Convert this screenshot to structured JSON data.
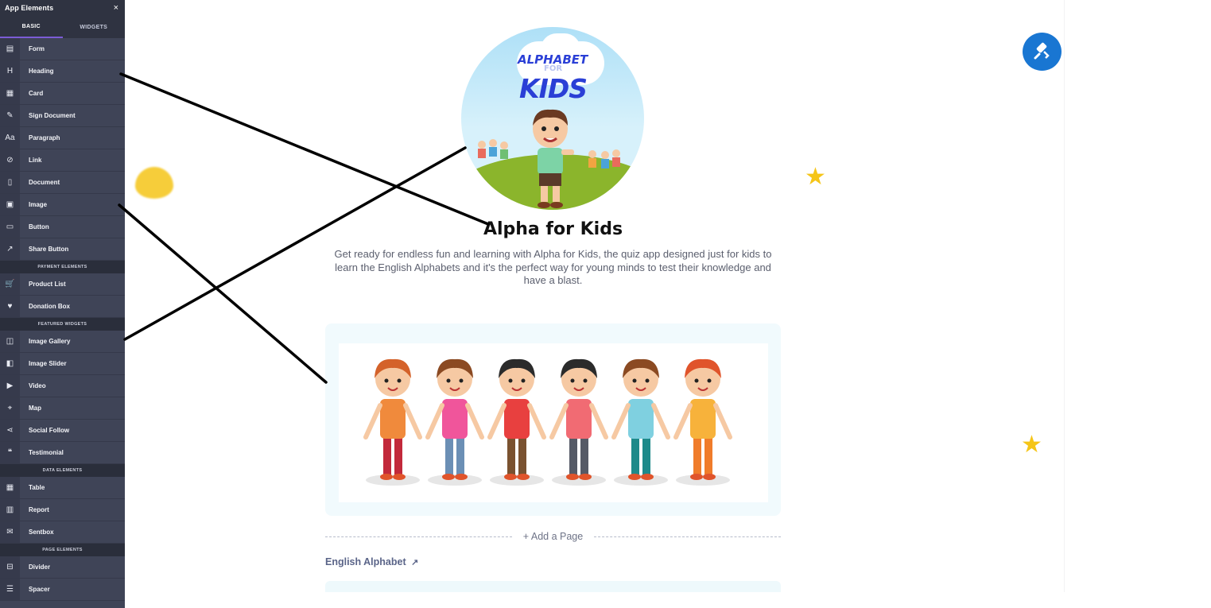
{
  "sidebar": {
    "title": "App Elements",
    "close_icon": "×",
    "tabs": [
      {
        "label": "BASIC",
        "active": true
      },
      {
        "label": "WIDGETS",
        "active": false
      }
    ],
    "basic_items": [
      {
        "label": "Form",
        "icon": "form-icon",
        "glyph": "▤"
      },
      {
        "label": "Heading",
        "icon": "heading-icon",
        "glyph": "H"
      },
      {
        "label": "Card",
        "icon": "card-icon",
        "glyph": "▦"
      },
      {
        "label": "Sign Document",
        "icon": "sign-document-icon",
        "glyph": "✎"
      },
      {
        "label": "Paragraph",
        "icon": "paragraph-icon",
        "glyph": "Aa"
      },
      {
        "label": "Link",
        "icon": "link-icon",
        "glyph": "⊘"
      },
      {
        "label": "Document",
        "icon": "document-icon",
        "glyph": "▯"
      },
      {
        "label": "Image",
        "icon": "image-icon",
        "glyph": "▣"
      },
      {
        "label": "Button",
        "icon": "button-icon",
        "glyph": "▭"
      },
      {
        "label": "Share Button",
        "icon": "share-button-icon",
        "glyph": "↗"
      }
    ],
    "payment_section": "PAYMENT ELEMENTS",
    "payment_items": [
      {
        "label": "Product List",
        "icon": "cart-icon",
        "glyph": "🛒"
      },
      {
        "label": "Donation Box",
        "icon": "heart-icon",
        "glyph": "♥"
      }
    ],
    "featured_section": "FEATURED WIDGETS",
    "featured_items": [
      {
        "label": "Image Gallery",
        "icon": "image-gallery-icon",
        "glyph": "◫"
      },
      {
        "label": "Image Slider",
        "icon": "image-slider-icon",
        "glyph": "◧"
      },
      {
        "label": "Video",
        "icon": "video-icon",
        "glyph": "▶"
      },
      {
        "label": "Map",
        "icon": "map-icon",
        "glyph": "⌖"
      },
      {
        "label": "Social Follow",
        "icon": "share-icon",
        "glyph": "⋖"
      },
      {
        "label": "Testimonial",
        "icon": "testimonial-icon",
        "glyph": "❝"
      }
    ],
    "data_section": "DATA ELEMENTS",
    "data_items": [
      {
        "label": "Table",
        "icon": "table-icon",
        "glyph": "▦"
      },
      {
        "label": "Report",
        "icon": "report-icon",
        "glyph": "▥"
      },
      {
        "label": "Sentbox",
        "icon": "sentbox-icon",
        "glyph": "✉"
      }
    ],
    "page_section": "PAGE ELEMENTS",
    "page_items": [
      {
        "label": "Divider",
        "icon": "divider-icon",
        "glyph": "⊟"
      },
      {
        "label": "Spacer",
        "icon": "spacer-icon",
        "glyph": "☰"
      }
    ]
  },
  "logo": {
    "alpha": "ALPHABET",
    "for": "FOR",
    "kids": "KIDS"
  },
  "app": {
    "title": "Alpha for Kids",
    "description": "Get ready for endless fun and learning with Alpha for Kids, the quiz app designed just for kids to learn the English Alphabets and  it's the perfect way for young minds to test their knowledge and have a blast."
  },
  "add_page": "+ Add a Page",
  "page_link": "English Alphabet",
  "page_link_icon": "external-link-icon",
  "fab_icon": "paint-roller-icon",
  "colors": {
    "sidebar": "#3f4457",
    "accent": "#1976d2",
    "tab_underline": "#7c5cd6",
    "card_bg": "#f1fafd"
  }
}
